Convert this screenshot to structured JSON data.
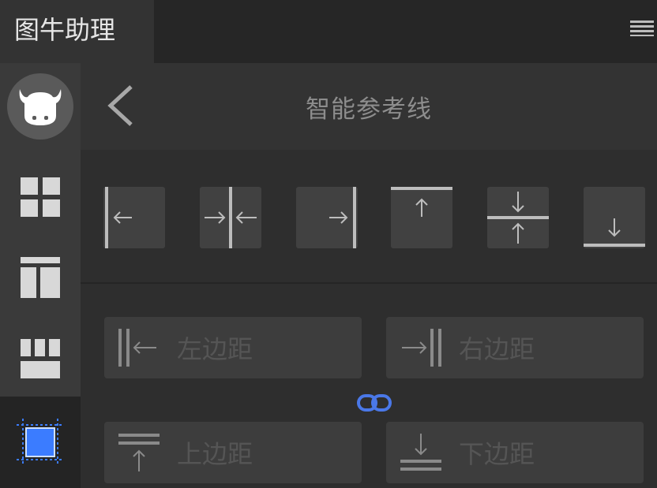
{
  "app": {
    "title": "图牛助理"
  },
  "topbar": {
    "menu_icon": "hamburger-menu-icon"
  },
  "sidebar": {
    "items": [
      {
        "icon": "cow-logo-icon",
        "active": false
      },
      {
        "icon": "grid-2x2-icon",
        "active": false
      },
      {
        "icon": "layout-template-icon",
        "active": false
      },
      {
        "icon": "columns-layout-icon",
        "active": false
      },
      {
        "icon": "guides-frame-icon",
        "active": true
      }
    ],
    "accent_color": "#3b7cff"
  },
  "header": {
    "title": "智能参考线",
    "back_icon": "chevron-left-icon"
  },
  "guide_buttons": [
    {
      "icon": "guide-left-icon"
    },
    {
      "icon": "guide-vertical-center-icon"
    },
    {
      "icon": "guide-right-icon"
    },
    {
      "icon": "guide-top-icon"
    },
    {
      "icon": "guide-horizontal-center-icon"
    },
    {
      "icon": "guide-bottom-icon"
    }
  ],
  "margins": {
    "left": {
      "placeholder": "左边距",
      "icon": "margin-left-icon"
    },
    "right": {
      "placeholder": "右边距",
      "icon": "margin-right-icon"
    },
    "top": {
      "placeholder": "上边距",
      "icon": "margin-top-icon"
    },
    "bottom": {
      "placeholder": "下边距",
      "icon": "margin-bottom-icon"
    },
    "link_icon": "link-icon",
    "link_color": "#4a78e8"
  }
}
